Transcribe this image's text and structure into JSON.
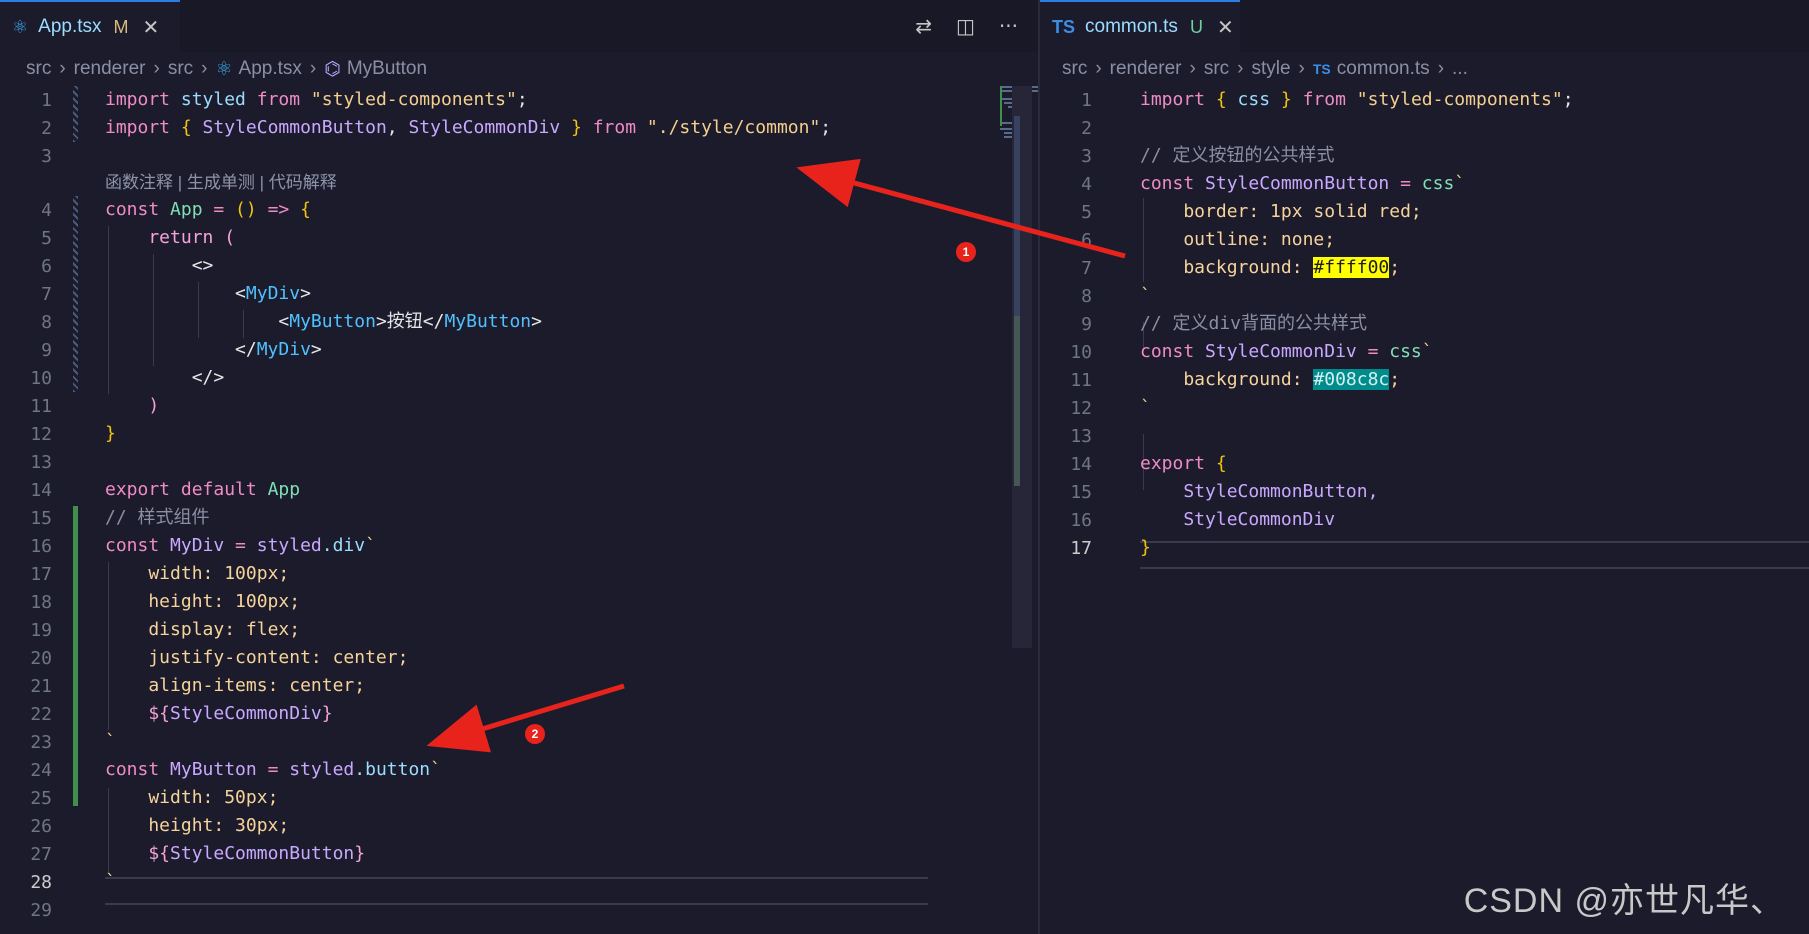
{
  "left": {
    "tab": {
      "icon": "react-icon",
      "label": "App.tsx",
      "status": "M",
      "close": "✕"
    },
    "actions": {
      "compare_icon": "⇄",
      "split_icon": "◫",
      "more_icon": "···"
    },
    "breadcrumb": [
      "src",
      "renderer",
      "src",
      "App.tsx",
      "MyButton"
    ],
    "codelens": {
      "a": "函数注释",
      "sep": " | ",
      "b": "生成单测",
      "c": "代码解释"
    },
    "line_numbers": [
      "1",
      "2",
      "3",
      "4",
      "5",
      "6",
      "7",
      "8",
      "9",
      "10",
      "11",
      "12",
      "13",
      "14",
      "15",
      "16",
      "17",
      "18",
      "19",
      "20",
      "21",
      "22",
      "23",
      "24",
      "25",
      "26",
      "27",
      "28",
      "29"
    ],
    "code": {
      "l1_a": "import",
      "l1_b": " styled ",
      "l1_c": "from",
      "l1_d": " \"styled-components\"",
      "l1_e": ";",
      "l2_a": "import",
      "l2_b": " { ",
      "l2_c": "StyleCommonButton",
      "l2_d": ", ",
      "l2_e": "StyleCommonDiv",
      "l2_f": " } ",
      "l2_g": "from",
      "l2_h": " \"./style/common\"",
      "l2_i": ";",
      "l4_a": "const",
      "l4_b": " App ",
      "l4_c": "=",
      "l4_d": " () ",
      "l4_e": "=>",
      "l4_f": " {",
      "l5_a": "    return",
      "l5_b": " (",
      "l6": "        <>",
      "l7_a": "            <",
      "l7_b": "MyDiv",
      "l7_c": ">",
      "l8_a": "                <",
      "l8_b": "MyButton",
      "l8_c": ">按钮</",
      "l8_d": "MyButton",
      "l8_e": ">",
      "l9_a": "            </",
      "l9_b": "MyDiv",
      "l9_c": ">",
      "l10": "        </>",
      "l11": "    )",
      "l12": "}",
      "l14_a": "export",
      "l14_b": " default",
      "l14_c": " App",
      "l15": "// 样式组件",
      "l16_a": "const",
      "l16_b": " MyDiv ",
      "l16_c": "=",
      "l16_d": " styled",
      "l16_e": ".div",
      "l16_f": "`",
      "l17_a": "    width",
      "l17_b": ": 100px;",
      "l18_a": "    height",
      "l18_b": ": 100px;",
      "l19_a": "    display",
      "l19_b": ": flex;",
      "l20_a": "    justify-content",
      "l20_b": ": center;",
      "l21_a": "    align-items",
      "l21_b": ": center;",
      "l22_a": "    ${",
      "l22_b": "StyleCommonDiv",
      "l22_c": "}",
      "l23": "`",
      "l24_a": "const",
      "l24_b": " MyButton ",
      "l24_c": "=",
      "l24_d": " styled",
      "l24_e": ".button",
      "l24_f": "`",
      "l25_a": "    width",
      "l25_b": ": 50px;",
      "l26_a": "    height",
      "l26_b": ": 30px;",
      "l27_a": "    ${",
      "l27_b": "StyleCommonButton",
      "l27_c": "}",
      "l28": "`"
    }
  },
  "right": {
    "tab": {
      "icon": "ts-icon",
      "icon_text": "TS",
      "label": "common.ts",
      "status": "U",
      "close": "✕"
    },
    "breadcrumb": [
      "src",
      "renderer",
      "src",
      "style",
      "common.ts",
      "..."
    ],
    "breadcrumb_icon": "TS",
    "line_numbers": [
      "1",
      "2",
      "3",
      "4",
      "5",
      "6",
      "7",
      "8",
      "9",
      "10",
      "11",
      "12",
      "13",
      "14",
      "15",
      "16",
      "17"
    ],
    "code": {
      "l1_a": "import",
      "l1_b": " { ",
      "l1_c": "css",
      "l1_d": " } ",
      "l1_e": "from",
      "l1_f": " \"styled-components\"",
      "l1_g": ";",
      "l3": "// 定义按钮的公共样式",
      "l4_a": "const",
      "l4_b": " StyleCommonButton ",
      "l4_c": "=",
      "l4_d": " css",
      "l4_e": "`",
      "l5_a": "    border",
      "l5_b": ": 1px solid red;",
      "l6_a": "    outline",
      "l6_b": ": none;",
      "l7_a": "    background",
      "l7_b": ": ",
      "l7_c": "#ffff00",
      "l7_d": ";",
      "l8": "`",
      "l9": "// 定义div背面的公共样式",
      "l10_a": "const",
      "l10_b": " StyleCommonDiv ",
      "l10_c": "=",
      "l10_d": " css",
      "l10_e": "`",
      "l11_a": "    background",
      "l11_b": ": ",
      "l11_c": "#008c8c",
      "l11_d": ";",
      "l12": "`",
      "l14_a": "export",
      "l14_b": " {",
      "l15": "    StyleCommonButton,",
      "l16": "    StyleCommonDiv",
      "l17": "}"
    }
  },
  "annotations": {
    "marker1": "1",
    "marker2": "2",
    "arrow_color": "#e8231c"
  },
  "watermark": "CSDN @亦世凡华、"
}
